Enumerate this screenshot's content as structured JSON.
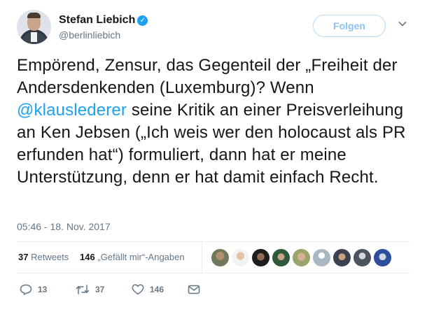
{
  "author": {
    "name": "Stefan Liebich",
    "handle": "@berlinliebich",
    "verified_icon": "verified-badge-icon"
  },
  "follow_label": "Folgen",
  "tweet": {
    "part1": "Empörend, Zensur, das Gegenteil der „Freiheit der Andersdenkenden (Luxemburg)? Wenn ",
    "mention": "@klauslederer",
    "part2": " seine Kritik an einer Preisverleihung an Ken Jebsen („Ich weis wer den holocaust als PR erfunden hat“) formuliert, dann hat er meine Unterstützung, denn er hat damit einfach Recht."
  },
  "timestamp": "05:46 - 18. Nov. 2017",
  "stats": {
    "retweets_count": "37",
    "retweets_label": "Retweets",
    "likes_count": "146",
    "likes_label": "„Gefällt mir“-Angaben"
  },
  "actions": {
    "reply_count": "13",
    "retweet_count": "37",
    "like_count": "146"
  },
  "colors": {
    "accent": "#1da1f2",
    "muted": "#657786",
    "text": "#14171a"
  }
}
